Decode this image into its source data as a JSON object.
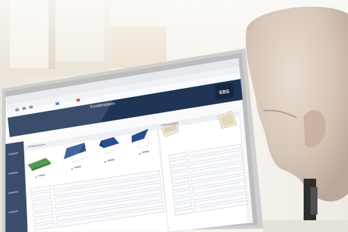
{
  "photo": {
    "colors": {
      "wall": "#f4f1ec",
      "window_light": "#faf8f5",
      "monitor_bezel": "#cfcfcf",
      "app_header": "#1f3556",
      "app_body": "#ffffff",
      "roof_blue": "#26508c",
      "roof_green": "#3d8f3a",
      "roof_beige": "#e7dcc7",
      "skin": "#d8c8bb"
    }
  },
  "screen": {
    "app_title": "Kundendaten",
    "logo": "EBS",
    "labels": {
      "left_panel_header": "Gebäudeaufnahme",
      "right_panel_header": "Gebäudeaufnahme"
    }
  }
}
